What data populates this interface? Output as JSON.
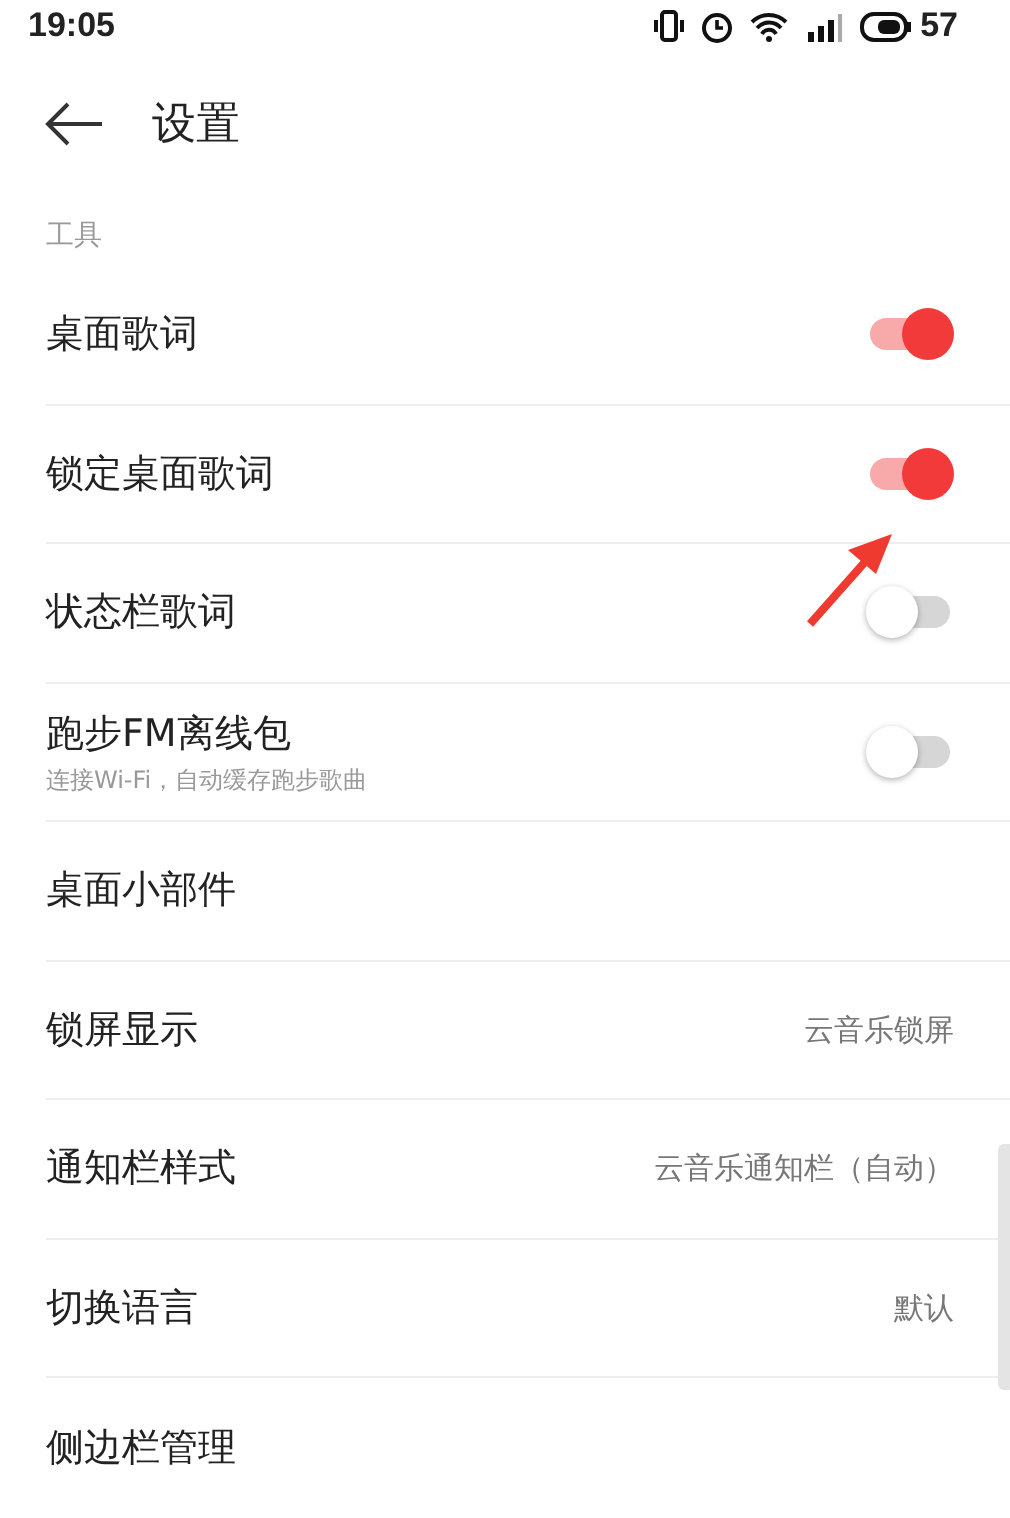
{
  "status_bar": {
    "time": "19:05",
    "battery": "57"
  },
  "header": {
    "title": "设置"
  },
  "section": {
    "title": "工具"
  },
  "items": [
    {
      "kind": "toggle",
      "label": "桌面歌词",
      "on": true
    },
    {
      "kind": "toggle",
      "label": "锁定桌面歌词",
      "on": true
    },
    {
      "kind": "toggle",
      "label": "状态栏歌词",
      "on": false
    },
    {
      "kind": "toggle",
      "label": "跑步FM离线包",
      "subtitle": "连接Wi-Fi，自动缓存跑步歌曲",
      "on": false
    },
    {
      "kind": "link",
      "label": "桌面小部件"
    },
    {
      "kind": "value",
      "label": "锁屏显示",
      "value": "云音乐锁屏"
    },
    {
      "kind": "value",
      "label": "通知栏样式",
      "value": "云音乐通知栏（自动）"
    },
    {
      "kind": "value",
      "label": "切换语言",
      "value": "默认"
    },
    {
      "kind": "link",
      "label": "侧边栏管理"
    }
  ]
}
